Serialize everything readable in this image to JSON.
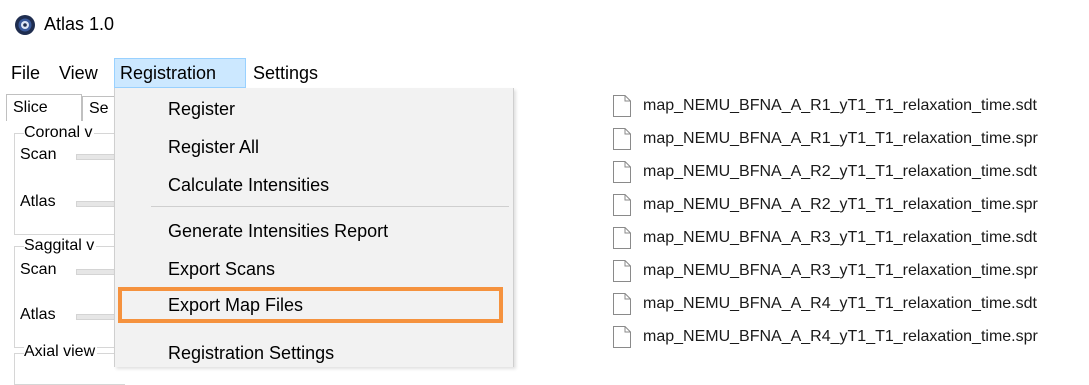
{
  "app": {
    "title": "Atlas 1.0",
    "icon": "atlas-app-icon"
  },
  "menubar": {
    "items": [
      {
        "label": "File",
        "active": false
      },
      {
        "label": "View",
        "active": false
      },
      {
        "label": "Registration",
        "active": true
      },
      {
        "label": "Settings",
        "active": false
      }
    ]
  },
  "left_panel": {
    "tabs": [
      {
        "label": "Slice"
      },
      {
        "label": "Se"
      }
    ],
    "groups": [
      {
        "title": "Coronal v",
        "rows": [
          {
            "label": "Scan"
          },
          {
            "label": "Atlas"
          }
        ]
      },
      {
        "title": "Saggital v",
        "rows": [
          {
            "label": "Scan"
          },
          {
            "label": "Atlas"
          }
        ]
      },
      {
        "title": "Axial view",
        "rows": []
      }
    ]
  },
  "registration_menu": {
    "items": [
      {
        "label": "Register"
      },
      {
        "label": "Register All"
      },
      {
        "label": "Calculate Intensities"
      },
      {
        "label": "Generate Intensities Report"
      },
      {
        "label": "Export Scans"
      },
      {
        "label": "Export Map Files",
        "highlighted": true
      },
      {
        "label": "Registration Settings"
      }
    ],
    "highlight_color": "#f5923e"
  },
  "file_list": {
    "icon": "file-icon",
    "items": [
      {
        "name": "map_NEMU_BFNA_A_R1_yT1_T1_relaxation_time.sdt"
      },
      {
        "name": "map_NEMU_BFNA_A_R1_yT1_T1_relaxation_time.spr"
      },
      {
        "name": "map_NEMU_BFNA_A_R2_yT1_T1_relaxation_time.sdt"
      },
      {
        "name": "map_NEMU_BFNA_A_R2_yT1_T1_relaxation_time.spr"
      },
      {
        "name": "map_NEMU_BFNA_A_R3_yT1_T1_relaxation_time.sdt"
      },
      {
        "name": "map_NEMU_BFNA_A_R3_yT1_T1_relaxation_time.spr"
      },
      {
        "name": "map_NEMU_BFNA_A_R4_yT1_T1_relaxation_time.sdt"
      },
      {
        "name": "map_NEMU_BFNA_A_R4_yT1_T1_relaxation_time.spr"
      }
    ]
  }
}
